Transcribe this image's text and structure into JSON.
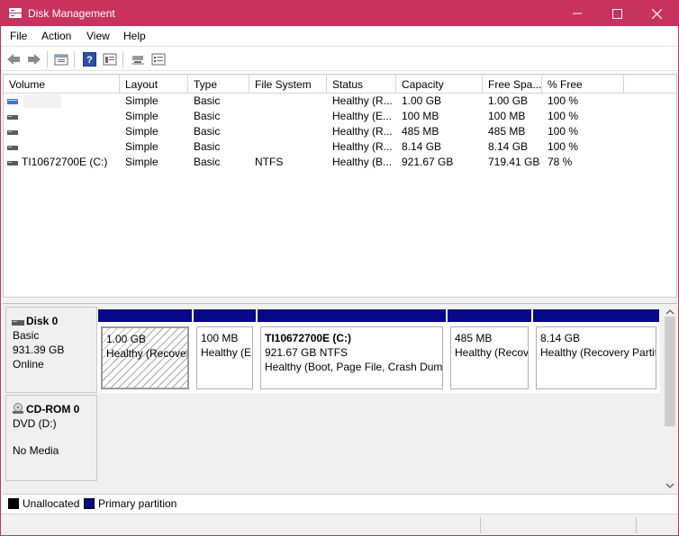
{
  "window": {
    "title": "Disk Management"
  },
  "menu": [
    "File",
    "Action",
    "View",
    "Help"
  ],
  "toolbar": {
    "icons": [
      "back-arrow-icon",
      "forward-arrow-icon",
      "properties-icon",
      "help-icon",
      "console-tree-icon",
      "connect-icon",
      "settings-list-icon"
    ]
  },
  "volume_list": {
    "columns": [
      "Volume",
      "Layout",
      "Type",
      "File System",
      "Status",
      "Capacity",
      "Free Spa...",
      "% Free"
    ],
    "rows": [
      {
        "volume": "",
        "layout": "Simple",
        "type": "Basic",
        "fs": "",
        "status": "Healthy (R...",
        "capacity": "1.00 GB",
        "free": "1.00 GB",
        "pct": "100 %"
      },
      {
        "volume": "",
        "layout": "Simple",
        "type": "Basic",
        "fs": "",
        "status": "Healthy (E...",
        "capacity": "100 MB",
        "free": "100 MB",
        "pct": "100 %"
      },
      {
        "volume": "",
        "layout": "Simple",
        "type": "Basic",
        "fs": "",
        "status": "Healthy (R...",
        "capacity": "485 MB",
        "free": "485 MB",
        "pct": "100 %"
      },
      {
        "volume": "",
        "layout": "Simple",
        "type": "Basic",
        "fs": "",
        "status": "Healthy (R...",
        "capacity": "8.14 GB",
        "free": "8.14 GB",
        "pct": "100 %"
      },
      {
        "volume": "TI10672700E (C:)",
        "layout": "Simple",
        "type": "Basic",
        "fs": "NTFS",
        "status": "Healthy (B...",
        "capacity": "921.67 GB",
        "free": "719.41 GB",
        "pct": "78 %"
      }
    ]
  },
  "disks": [
    {
      "name": "Disk 0",
      "lines": [
        "Basic",
        "931.39 GB",
        "Online"
      ],
      "partitions": [
        {
          "title": "",
          "line1": "1.00 GB",
          "line2": "Healthy (Recovery Partition)",
          "selected": true
        },
        {
          "title": "",
          "line1": "100 MB",
          "line2": "Healthy (EFI System Partition)",
          "selected": false
        },
        {
          "title": "TI10672700E  (C:)",
          "line1": "921.67 GB NTFS",
          "line2": "Healthy (Boot, Page File, Crash Dump, Primary Partition)",
          "selected": false
        },
        {
          "title": "",
          "line1": "485 MB",
          "line2": "Healthy (Recovery Partition)",
          "selected": false
        },
        {
          "title": "",
          "line1": "8.14 GB",
          "line2": "Healthy (Recovery Partition)",
          "selected": false
        }
      ]
    },
    {
      "name": "CD-ROM 0",
      "lines": [
        "DVD (D:)",
        "",
        "No Media"
      ]
    }
  ],
  "legend": [
    {
      "label": "Unallocated",
      "color": "#000000"
    },
    {
      "label": "Primary partition",
      "color": "#08088a"
    }
  ],
  "colors": {
    "titlebar": "#c8325f",
    "primary_partition": "#08088a"
  }
}
